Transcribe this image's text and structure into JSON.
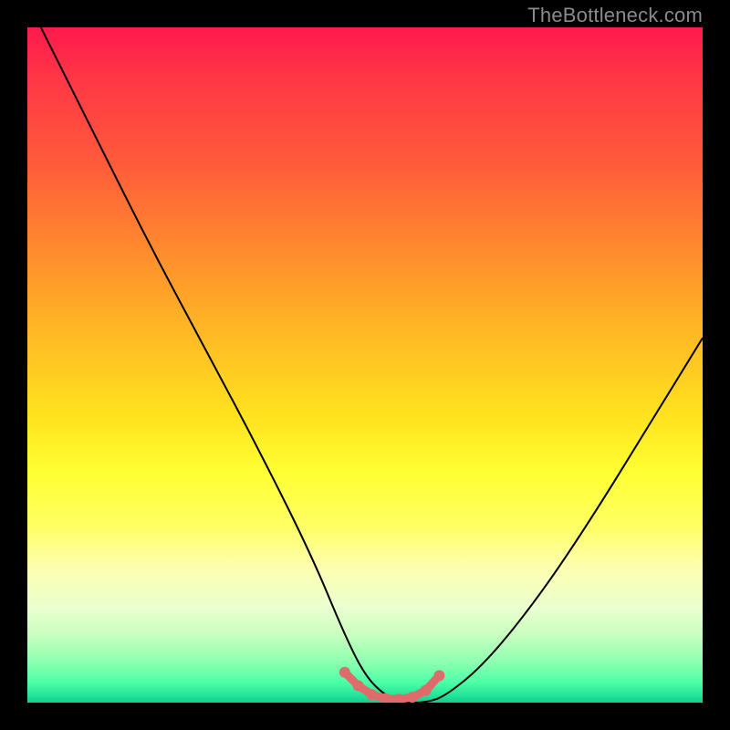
{
  "watermark": "TheBottleneck.com",
  "chart_data": {
    "type": "line",
    "title": "",
    "xlabel": "",
    "ylabel": "",
    "xlim": [
      0,
      100
    ],
    "ylim": [
      0,
      100
    ],
    "series": [
      {
        "name": "bottleneck-curve",
        "x": [
          2,
          10,
          18,
          26,
          34,
          42,
          47,
          50,
          53,
          56,
          59,
          62,
          68,
          76,
          84,
          92,
          100
        ],
        "values": [
          100,
          84,
          68,
          53,
          38,
          22,
          10,
          4,
          1,
          0,
          0,
          1,
          6,
          16,
          28,
          41,
          54
        ]
      }
    ],
    "trough_marker": {
      "x": [
        47,
        49,
        51,
        53,
        55,
        57,
        59,
        61
      ],
      "values": [
        4.5,
        2.5,
        1.2,
        0.6,
        0.5,
        0.8,
        1.8,
        4.0
      ],
      "color": "#e06b6b"
    }
  }
}
